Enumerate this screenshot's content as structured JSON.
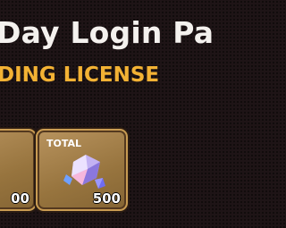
{
  "header": {
    "title": "Day Login Pa",
    "subtitle": "DING LICENSE"
  },
  "rewards": [
    {
      "tag": "",
      "quantity": "00",
      "icon": "crystal-shard-icon"
    },
    {
      "tag": "TOTAL",
      "quantity": "500",
      "icon": "crystal-shard-icon"
    }
  ],
  "colors": {
    "background": "#1e1416",
    "title": "#f4f1ee",
    "subtitle": "#f3b234",
    "card_fill": "#a07a44",
    "card_border": "#c89b52"
  }
}
